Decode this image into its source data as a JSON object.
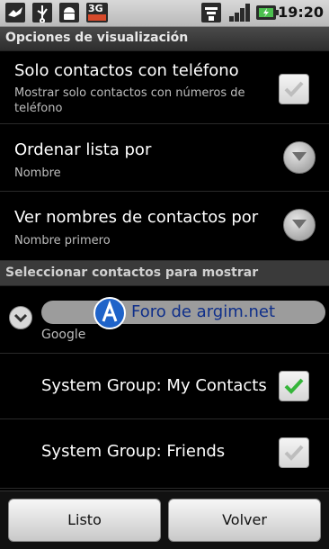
{
  "statusbar": {
    "network_type": "3G",
    "time": "19:20",
    "icons": [
      "notification-bird-icon",
      "usb-icon",
      "android-debug-icon",
      "3g-icon",
      "wifi-icon",
      "signal-icon",
      "battery-charging-icon"
    ]
  },
  "title": "Opciones de visualización",
  "rows": [
    {
      "title": "Solo contactos con teléfono",
      "subtitle": "Mostrar solo contactos con números de teléfono",
      "checked": true,
      "enabled": false
    },
    {
      "title": "Ordenar lista por",
      "subtitle": "Nombre"
    },
    {
      "title": "Ver nombres de contactos por",
      "subtitle": "Nombre primero"
    }
  ],
  "section_header": "Seleccionar contactos para mostrar",
  "account": {
    "subtitle": "Google"
  },
  "watermark": {
    "text": "Foro de argim.net"
  },
  "groups": [
    {
      "title": "System Group: My Contacts",
      "checked": true,
      "enabled": true
    },
    {
      "title": "System Group: Friends",
      "checked": true,
      "enabled": false
    }
  ],
  "buttons": {
    "ok_label": "Listo",
    "back_label": "Volver"
  },
  "colors": {
    "check_green": "#35b53a",
    "check_gray": "#bdbdbd",
    "watermark_blue": "#1f63c9"
  }
}
